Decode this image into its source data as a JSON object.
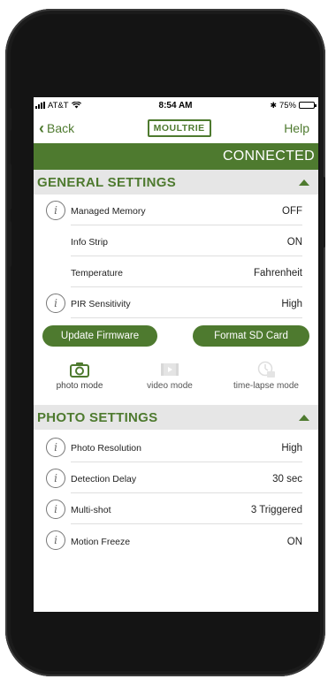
{
  "status_bar": {
    "carrier": "AT&T",
    "time": "8:54 AM",
    "battery": "75%",
    "battery_level": 0.75
  },
  "nav": {
    "back_label": "Back",
    "logo_text": "MOULTRIE",
    "help_label": "Help"
  },
  "connection": {
    "status": "CONNECTED"
  },
  "general_settings": {
    "title": "GENERAL SETTINGS",
    "items": [
      {
        "label": "Managed Memory",
        "value": "OFF",
        "info": true
      },
      {
        "label": "Info Strip",
        "value": "ON",
        "info": false
      },
      {
        "label": "Temperature",
        "value": "Fahrenheit",
        "info": false
      },
      {
        "label": "PIR Sensitivity",
        "value": "High",
        "info": true
      }
    ],
    "update_firmware_label": "Update Firmware",
    "format_sd_label": "Format SD Card"
  },
  "modes": {
    "photo": "photo mode",
    "video": "video mode",
    "timelapse": "time-lapse mode",
    "selected": "photo mode"
  },
  "photo_settings": {
    "title": "PHOTO SETTINGS",
    "items": [
      {
        "label": "Photo Resolution",
        "value": "High"
      },
      {
        "label": "Detection Delay",
        "value": "30 sec"
      },
      {
        "label": "Multi-shot",
        "value": "3 Triggered"
      },
      {
        "label": "Motion Freeze",
        "value": "ON"
      }
    ]
  },
  "colors": {
    "accent": "#4e7a2f",
    "section_bg": "#e6e6e6"
  }
}
